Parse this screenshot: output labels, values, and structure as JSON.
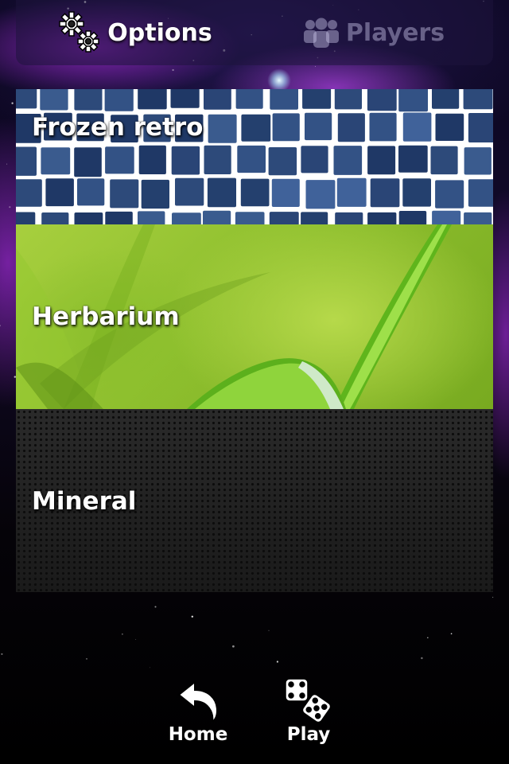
{
  "tabs": [
    {
      "label": "Options",
      "icon": "gears-icon",
      "active": true
    },
    {
      "label": "Players",
      "icon": "users-icon",
      "active": false
    }
  ],
  "themes": [
    {
      "label": "Frozen retro",
      "style": "blue mosaic tiles"
    },
    {
      "label": "Herbarium",
      "style": "green grass"
    },
    {
      "label": "Mineral",
      "style": "dark perforated metal"
    }
  ],
  "bottom_bar": {
    "home_label": "Home",
    "play_label": "Play"
  },
  "colors": {
    "tile_blue": "#2d4a7a",
    "grout": "#ffffff",
    "grass_green": "#8ebf2e",
    "mineral_dark": "#1f1f1f",
    "nebula_purple": "#9628c8"
  }
}
